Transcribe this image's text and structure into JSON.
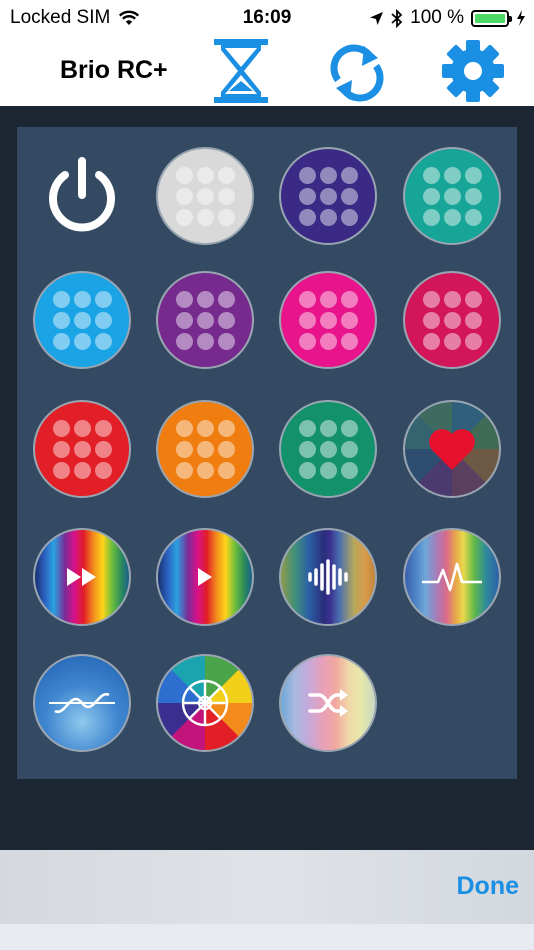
{
  "status_bar": {
    "carrier": "Locked SIM",
    "time": "16:09",
    "battery_percent": "100 %",
    "battery_level": 1.0
  },
  "nav": {
    "title": "Brio RC+",
    "icons": [
      "hourglass-icon",
      "refresh-icon",
      "gear-icon"
    ],
    "accent": "#1a8fe3"
  },
  "grid": {
    "buttons": [
      {
        "name": "power-icon"
      },
      {
        "color": "#d9d9d9"
      },
      {
        "color": "#3a2a86"
      },
      {
        "color": "#16a596"
      },
      {
        "color": "#1aa4e6"
      },
      {
        "color": "#762a8e"
      },
      {
        "color": "#e8148c"
      },
      {
        "color": "#d3155a"
      },
      {
        "color": "#e21e26"
      },
      {
        "color": "#ef7d10"
      },
      {
        "color": "#12916a"
      },
      {
        "name": "heart-icon"
      },
      {
        "name": "fast-forward-icon"
      },
      {
        "name": "play-icon"
      },
      {
        "name": "sound-wave-icon"
      },
      {
        "name": "heartbeat-icon"
      },
      {
        "name": "sine-wave-icon"
      },
      {
        "name": "color-wheel-icon"
      },
      {
        "name": "shuffle-icon"
      }
    ]
  },
  "bottom_bar": {
    "done_label": "Done"
  }
}
